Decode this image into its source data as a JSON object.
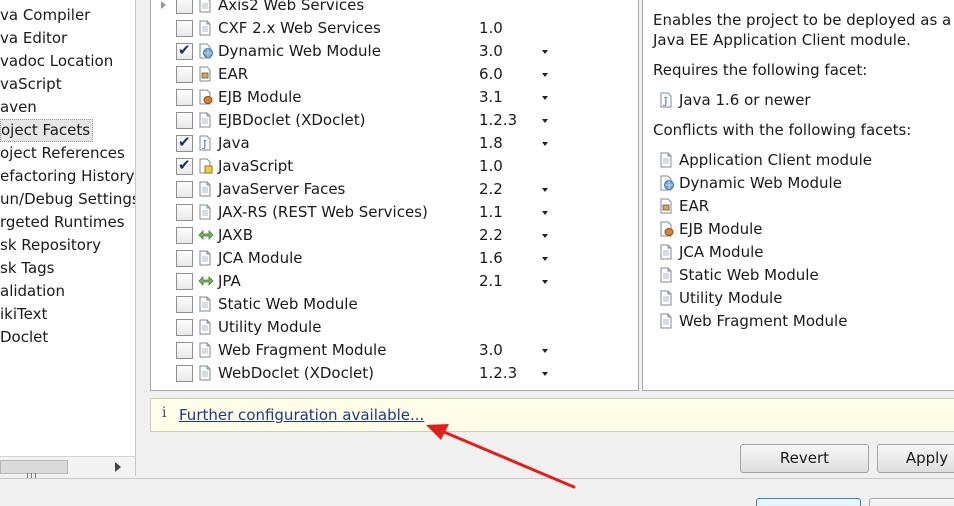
{
  "nav": {
    "items": [
      {
        "label": "va Compiler"
      },
      {
        "label": "va Editor"
      },
      {
        "label": "vadoc Location"
      },
      {
        "label": "vaScript"
      },
      {
        "label": "aven"
      },
      {
        "label": "oject Facets",
        "selected": true
      },
      {
        "label": "oject References"
      },
      {
        "label": "efactoring History"
      },
      {
        "label": "un/Debug Settings"
      },
      {
        "label": "rgeted Runtimes"
      },
      {
        "label": "sk Repository"
      },
      {
        "label": "sk Tags"
      },
      {
        "label": "alidation"
      },
      {
        "label": "ikiText"
      },
      {
        "label": "Doclet"
      }
    ]
  },
  "facets": [
    {
      "name": "Axis2 Web Services",
      "version": "",
      "checked": false,
      "icon": "folder-icon",
      "expandable": true,
      "dropdown": false
    },
    {
      "name": "CXF 2.x Web Services",
      "version": "1.0",
      "checked": false,
      "icon": "page-icon",
      "expandable": false,
      "dropdown": false
    },
    {
      "name": "Dynamic Web Module",
      "version": "3.0",
      "checked": true,
      "icon": "web-module-icon",
      "expandable": false,
      "dropdown": true
    },
    {
      "name": "EAR",
      "version": "6.0",
      "checked": false,
      "icon": "ear-icon",
      "expandable": false,
      "dropdown": true
    },
    {
      "name": "EJB Module",
      "version": "3.1",
      "checked": false,
      "icon": "ejb-icon",
      "expandable": false,
      "dropdown": true
    },
    {
      "name": "EJBDoclet (XDoclet)",
      "version": "1.2.3",
      "checked": false,
      "icon": "page-icon",
      "expandable": false,
      "dropdown": true
    },
    {
      "name": "Java",
      "version": "1.8",
      "checked": true,
      "icon": "java-icon",
      "expandable": false,
      "dropdown": true
    },
    {
      "name": "JavaScript",
      "version": "1.0",
      "checked": true,
      "icon": "javascript-icon",
      "expandable": false,
      "dropdown": false
    },
    {
      "name": "JavaServer Faces",
      "version": "2.2",
      "checked": false,
      "icon": "page-icon",
      "expandable": false,
      "dropdown": true
    },
    {
      "name": "JAX-RS (REST Web Services)",
      "version": "1.1",
      "checked": false,
      "icon": "page-icon",
      "expandable": false,
      "dropdown": true
    },
    {
      "name": "JAXB",
      "version": "2.2",
      "checked": false,
      "icon": "bind-icon",
      "expandable": false,
      "dropdown": true
    },
    {
      "name": "JCA Module",
      "version": "1.6",
      "checked": false,
      "icon": "page-icon",
      "expandable": false,
      "dropdown": true
    },
    {
      "name": "JPA",
      "version": "2.1",
      "checked": false,
      "icon": "bind-icon",
      "expandable": false,
      "dropdown": true
    },
    {
      "name": "Static Web Module",
      "version": "",
      "checked": false,
      "icon": "page-icon",
      "expandable": false,
      "dropdown": false
    },
    {
      "name": "Utility Module",
      "version": "",
      "checked": false,
      "icon": "page-icon",
      "expandable": false,
      "dropdown": false
    },
    {
      "name": "Web Fragment Module",
      "version": "3.0",
      "checked": false,
      "icon": "page-icon",
      "expandable": false,
      "dropdown": true
    },
    {
      "name": "WebDoclet (XDoclet)",
      "version": "1.2.3",
      "checked": false,
      "icon": "page-icon",
      "expandable": false,
      "dropdown": true
    }
  ],
  "details": {
    "description_line1": "Enables the project to be deployed as a",
    "description_line2": "Java EE Application Client module.",
    "requires_heading": "Requires the following facet:",
    "requires": [
      {
        "label": "Java 1.6 or newer",
        "icon": "java-icon"
      }
    ],
    "conflicts_heading": "Conflicts with the following facets:",
    "conflicts": [
      {
        "label": "Application Client module",
        "icon": "page-icon"
      },
      {
        "label": "Dynamic Web Module",
        "icon": "web-module-icon"
      },
      {
        "label": "EAR",
        "icon": "ear-icon"
      },
      {
        "label": "EJB Module",
        "icon": "ejb-icon"
      },
      {
        "label": "JCA Module",
        "icon": "page-icon"
      },
      {
        "label": "Static Web Module",
        "icon": "page-icon"
      },
      {
        "label": "Utility Module",
        "icon": "page-icon"
      },
      {
        "label": "Web Fragment Module",
        "icon": "page-icon"
      }
    ]
  },
  "infobar": {
    "icon_glyph": "i",
    "link_text": "Further configuration available..."
  },
  "buttons": {
    "revert": "Revert",
    "apply": "Apply"
  },
  "scrollbar": {
    "grip_icon": "grip-icon",
    "arrow_icon": "arrow-right-icon"
  },
  "colors": {
    "annotation_arrow": "#e0211b",
    "link": "#1a3a8a",
    "infobar_bg": "#fffde7",
    "checkmark": "#1d2f6b"
  }
}
